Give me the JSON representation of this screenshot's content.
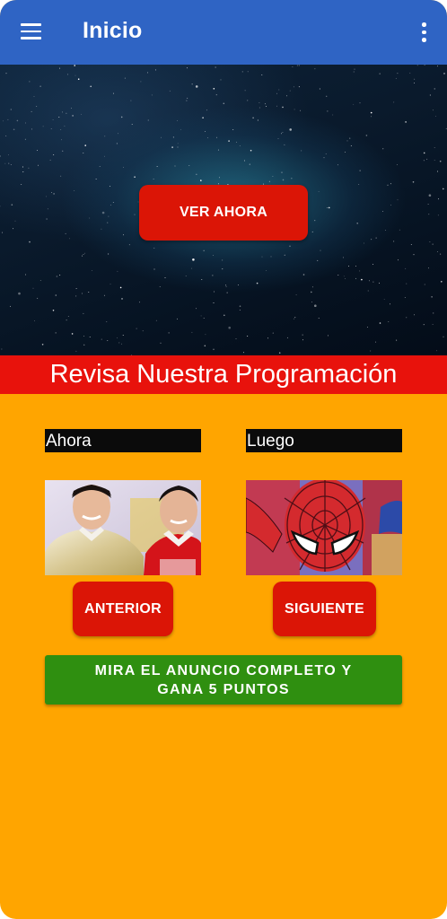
{
  "appbar": {
    "title": "Inicio",
    "menu_icon": "menu-icon",
    "overflow_icon": "more-vert-icon",
    "color": "#2F64C4"
  },
  "hero": {
    "watch_label": "VER AHORA"
  },
  "banner": {
    "text": "Revisa Nuestra Programación",
    "color": "#E8120C"
  },
  "schedule": {
    "now_label": "Ahora",
    "next_label": "Luego",
    "now_image": "power-rangers-thumbnail",
    "next_image": "spiderman-thumbnail",
    "prev_button": "ANTERIOR",
    "next_button": "SIGUIENTE"
  },
  "ad": {
    "label": "MIRA EL ANUNCIO COMPLETO Y GANA 5 PUNTOS",
    "color": "#2F8F10"
  },
  "background_color": "#FFA500"
}
